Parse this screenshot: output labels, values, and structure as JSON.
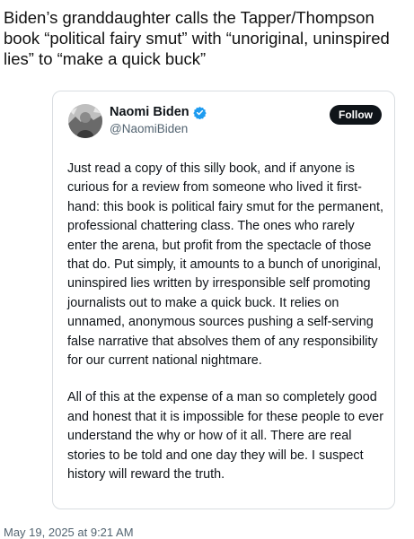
{
  "headline": "Biden’s granddaughter calls the Tapper/Thompson book “political fairy smut” with “unoriginal, uninspired lies” to “make a quick buck”",
  "tweet": {
    "author_name": "Naomi Biden",
    "handle": "@NaomiBiden",
    "verified": true,
    "follow_label": "Follow",
    "paragraphs": [
      "Just read a copy of this silly book, and if anyone is curious for a review from someone who lived it first-hand: this book is political fairy smut for the permanent, professional chattering class. The ones who rarely enter the arena, but profit from the spectacle of those that do. Put simply, it amounts to a bunch of unoriginal, uninspired lies written by irresponsible self promoting journalists out to make a quick buck.  It relies on unnamed, anonymous sources pushing a self-serving false narrative that absolves them of any responsibility for our current national nightmare.",
      "All of this at the expense of a man so completely good and honest that it is impossible for these people to ever understand the why or how of it all. There are real stories to be told and one day they will be. I suspect history will reward the truth."
    ],
    "timestamp": "May 19, 2025 at 9:21 AM"
  },
  "colors": {
    "verified_badge": "#1d9bf0",
    "follow_button": "#0f1419",
    "secondary_text": "#536471",
    "card_border": "#d9dde1"
  },
  "icons": {
    "avatar": "profile-photo",
    "verified": "verified-badge-icon"
  }
}
